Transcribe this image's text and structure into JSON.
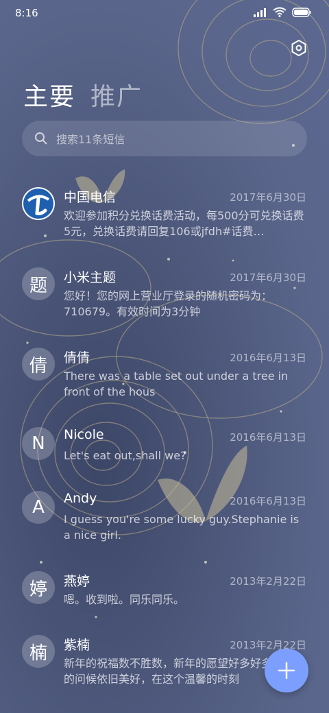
{
  "status_bar": {
    "time": "8:16"
  },
  "tabs": [
    {
      "label": "主要",
      "active": true
    },
    {
      "label": "推广",
      "active": false
    }
  ],
  "search": {
    "placeholder": "搜索11条短信"
  },
  "messages": [
    {
      "avatar": "",
      "avatar_icon": "china-telecom-logo",
      "sender": "中国电信",
      "date": "2017年6月30日",
      "preview": "欢迎参加积分兑换话费活动，每500分可兑换话费5元，兑换话费请回复106或jfdh#话费…"
    },
    {
      "avatar": "题",
      "sender": "小米主题",
      "date": "2017年6月30日",
      "preview": "您好！您的网上营业厅登录的随机密码为：710679。有效时间为3分钟"
    },
    {
      "avatar": "倩",
      "sender": "倩倩",
      "date": "2016年6月13日",
      "preview": "There was a table set out under a tree in front of the hous"
    },
    {
      "avatar": "N",
      "sender": "Nicole",
      "date": "2016年6月13日",
      "preview": "Let's eat out,shall we?"
    },
    {
      "avatar": "A",
      "sender": "Andy",
      "date": "2016年6月13日",
      "preview": "I guess you're some lucky guy.Stephanie is a nice girl."
    },
    {
      "avatar": "婷",
      "sender": "燕婷",
      "date": "2013年2月22日",
      "preview": "嗯。收到啦。同乐同乐。"
    },
    {
      "avatar": "楠",
      "sender": "紫楠",
      "date": "2013年2月22日",
      "preview": "新年的祝福数不胜数，新年的愿望好多好多，新年的问候依旧美好，在这个温馨的时刻"
    }
  ],
  "colors": {
    "accent": "#7c9fff",
    "background": "#55618a"
  }
}
